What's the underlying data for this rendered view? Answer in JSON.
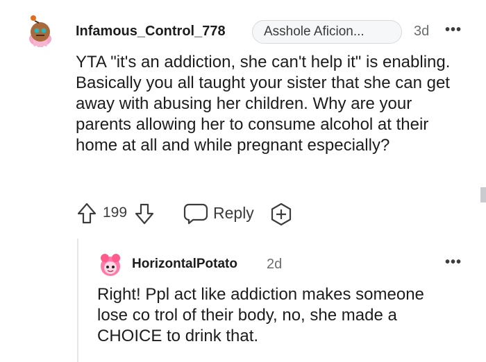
{
  "comment": {
    "author": "Infamous_Control_778",
    "flair": "Asshole Aficion...",
    "time": "3d",
    "more": "•••",
    "body": "YTA \"it's an addiction, she can't help it\" is enabling. Basically you all taught your sister that she can get away with abusing her children. Why are your parents allowing her to consume alcohol at their home at all and while pregnant especially?",
    "votes": "199",
    "reply_label": "Reply",
    "icons": [
      "avatar",
      "upvote-icon",
      "downvote-icon",
      "comment-bubble-icon",
      "award-add-icon",
      "more-icon"
    ]
  },
  "reply": {
    "author": "HorizontalPotato",
    "time": "2d",
    "more": "•••",
    "body": "Right! Ppl act like addiction makes someone lose co trol of their body, no, she made a CHOICE to drink that.",
    "icons": [
      "avatar",
      "more-icon"
    ]
  },
  "colors": {
    "text": "#1c1c1c",
    "meta": "#6a6c70",
    "flair_bg": "#f6f7f8",
    "thread_line": "#e5e6e8"
  }
}
